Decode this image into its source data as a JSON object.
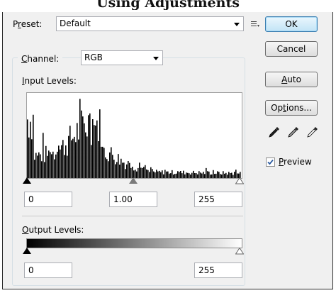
{
  "title_partial": "Using Adjustments",
  "preset": {
    "label": "Preset:",
    "value": "Default"
  },
  "channel": {
    "label": "Channel:",
    "value": "RGB"
  },
  "input_levels": {
    "label": "Input Levels:",
    "black": "0",
    "gamma": "1.00",
    "white": "255"
  },
  "output_levels": {
    "label": "Output Levels:",
    "black": "0",
    "white": "255"
  },
  "buttons": {
    "ok": "OK",
    "cancel": "Cancel",
    "auto": "Auto",
    "options": "Options..."
  },
  "preview": {
    "label": "Preview",
    "checked": true
  },
  "colors": {
    "ok_border": "#3c7fb1",
    "panel_bg": "#f0f0f0"
  }
}
